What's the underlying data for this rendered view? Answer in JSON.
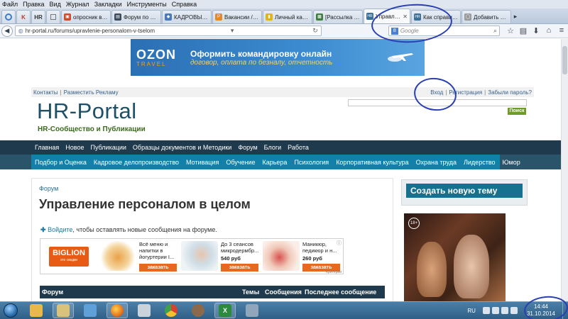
{
  "menu": [
    "Файл",
    "Правка",
    "Вид",
    "Журнал",
    "Закладки",
    "Инструменты",
    "Справка"
  ],
  "pinned_tabs": [
    {
      "label": "",
      "color": "#5b87c9"
    },
    {
      "label": "K",
      "color": "#c0392b"
    },
    {
      "label": "HR",
      "color": "#555555"
    },
    {
      "label": "",
      "color": "#777777"
    }
  ],
  "tabs": [
    {
      "label": "опросник во...",
      "color": "#d04a2a",
      "fav": "▣"
    },
    {
      "label": "Форум по м...",
      "color": "#3c4b5c",
      "fav": "▤"
    },
    {
      "label": "КАДРОВЫЙ ...",
      "color": "#4b79b8",
      "fav": "◆"
    },
    {
      "label": "Вакансии / Р...",
      "color": "#e8862a",
      "fav": "P"
    },
    {
      "label": "Личный каб...",
      "color": "#e0b22a",
      "fav": "▮"
    },
    {
      "label": "[Рассылка Н...",
      "color": "#3f7d3f",
      "fav": "▩"
    },
    {
      "label": "Управлен...",
      "color": "#3a6f96",
      "fav": "HR",
      "active": true
    },
    {
      "label": "Как справит...",
      "color": "#3a6f96",
      "fav": "HR"
    },
    {
      "label": "Добавить Те...",
      "color": "#999999",
      "fav": "◯"
    }
  ],
  "nav": {
    "url": "hr-portal.ru/forums/upravlenie-personalom-v-tselom",
    "search_placeholder": "Google"
  },
  "banner": {
    "brand": "OZON",
    "brand_sub": "TRAVEL",
    "headline": "Оформить командировку онлайн",
    "subline": "договор, оплата по безналу, отчетность"
  },
  "topbar": {
    "contacts": "Контакты",
    "advertise": "Разместить Рекламу",
    "login": "Вход",
    "register": "Регистрация",
    "forgot": "Забыли пароль?"
  },
  "site": {
    "title": "HR-Portal",
    "subtitle": "HR-Сообщество и Публикации",
    "search_button": "Поиск"
  },
  "main_nav": [
    "Главная",
    "Новое",
    "Публикации",
    "Образцы документов и Методики",
    "Форум",
    "Блоги",
    "Работа"
  ],
  "sub_nav": [
    "Подбор и Оценка",
    "Кадровое делопроизводство",
    "Мотивация",
    "Обучение",
    "Карьера",
    "Психология",
    "Корпоративная культура",
    "Охрана труда",
    "Лидерство",
    "Юмор"
  ],
  "content": {
    "breadcrumb": "Форум",
    "title": "Управление персоналом в целом",
    "login_link": "Войдите",
    "login_rest": ", чтобы оставлять новые сообщения на форуме."
  },
  "ads": {
    "logo": "BIGLION",
    "logo_sub": "это скидки",
    "info": "ⓘ",
    "footer": "Критерии",
    "items": [
      {
        "text": "Всё меню и напитки в йогуртерии I...",
        "price": "",
        "button": "заказать",
        "color": "#f2c27a"
      },
      {
        "text": "До 3 сеансов микродермбр...",
        "price": "540 руб",
        "button": "заказать",
        "color": "#dfe8ef"
      },
      {
        "text": "Маникюр, педикюр и н...",
        "price": "260 руб",
        "button": "заказать",
        "color": "#f1d2c4"
      }
    ]
  },
  "table": {
    "columns": [
      "Форум",
      "Темы",
      "Сообщения",
      "Последнее сообщение"
    ]
  },
  "sidebar": {
    "new_topic": "Создать новую тему",
    "poster_age": "18+"
  },
  "taskbar": {
    "apps": [
      {
        "name": "folder",
        "color": "#e8b84a",
        "label": ""
      },
      {
        "name": "files",
        "color": "#d9c27a",
        "label": ""
      },
      {
        "name": "tools",
        "color": "#5fa0d8",
        "label": ""
      },
      {
        "name": "firefox",
        "color": "#e8761f",
        "label": ""
      },
      {
        "name": "calculator",
        "color": "#c9d3dc",
        "label": ""
      },
      {
        "name": "chrome",
        "color": "#3ea04a",
        "label": ""
      },
      {
        "name": "agent",
        "color": "#8a6a4a",
        "label": ""
      },
      {
        "name": "excel",
        "color": "#2c8a3f",
        "label": "X"
      },
      {
        "name": "disk",
        "color": "#8fa6bd",
        "label": ""
      }
    ],
    "lang": "RU",
    "time": "14:44",
    "date": "31.10.2014"
  }
}
